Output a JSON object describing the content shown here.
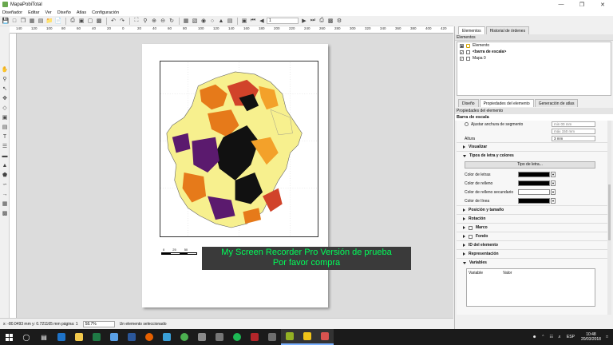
{
  "window": {
    "title": "MapaPobiTotal"
  },
  "menu": [
    "Diseñador",
    "Editar",
    "Ver",
    "Diseño",
    "Atlas",
    "Configuración"
  ],
  "toolbar": {
    "page_field": "1"
  },
  "ruler": [
    "140",
    "120",
    "100",
    "80",
    "60",
    "40",
    "20",
    "0",
    "20",
    "40",
    "60",
    "80",
    "100",
    "120",
    "140",
    "160",
    "180",
    "200",
    "220",
    "240",
    "260",
    "280",
    "300",
    "320",
    "340",
    "360",
    "380",
    "400",
    "420"
  ],
  "map": {
    "scale_labels": [
      "0",
      "25",
      "50"
    ]
  },
  "watermark": {
    "line1": "My Screen Recorder Pro Versión de prueba",
    "line2": "Por favor compra"
  },
  "status": {
    "coords": "x: -80.0493 mm   y: 0.721165 mm   página: 1",
    "zoom": "58.7%",
    "selection": "Un elemento seleccionado"
  },
  "panel": {
    "tabs": [
      "Elementos",
      "Historial de órdenes"
    ],
    "elements_header": "Elementos",
    "elements": {
      "column": "Elemento",
      "items": [
        "<barra de escala>",
        "Mapa 0"
      ]
    },
    "prop_tabs": [
      "Diseño",
      "Propiedades del elemento",
      "Generación de atlas"
    ],
    "props_header": "Propiedades del elemento",
    "props_title": "Barra de escala",
    "fit_width": "Ajustar anchura de segmento",
    "spin1": "min 00 mm",
    "spin2": "máx 150 mm",
    "height_label": "Altura",
    "height_value": "3 mm",
    "groups": {
      "visualizar": "Visualizar",
      "fonts": "Tipos de letra y colores",
      "position": "Posición y tamaño",
      "rotation": "Rotación",
      "frame": "Marco",
      "background": "Fondo",
      "id": "ID del elemento",
      "render": "Representación",
      "variables": "Variables"
    },
    "font_button": "Tipo de letra...",
    "colors": {
      "font": "Color de letras",
      "fill": "Color de relleno",
      "fill2": "Color de relleno secundario",
      "line": "Color de línea"
    },
    "vars_cols": [
      "Variable",
      "Valor"
    ]
  },
  "taskbar": {
    "time": "10:48",
    "date": "20/03/2018",
    "lang": "ESP"
  },
  "colors": {
    "accent": "#0078d7",
    "watermark_text": "#00ff5a"
  }
}
